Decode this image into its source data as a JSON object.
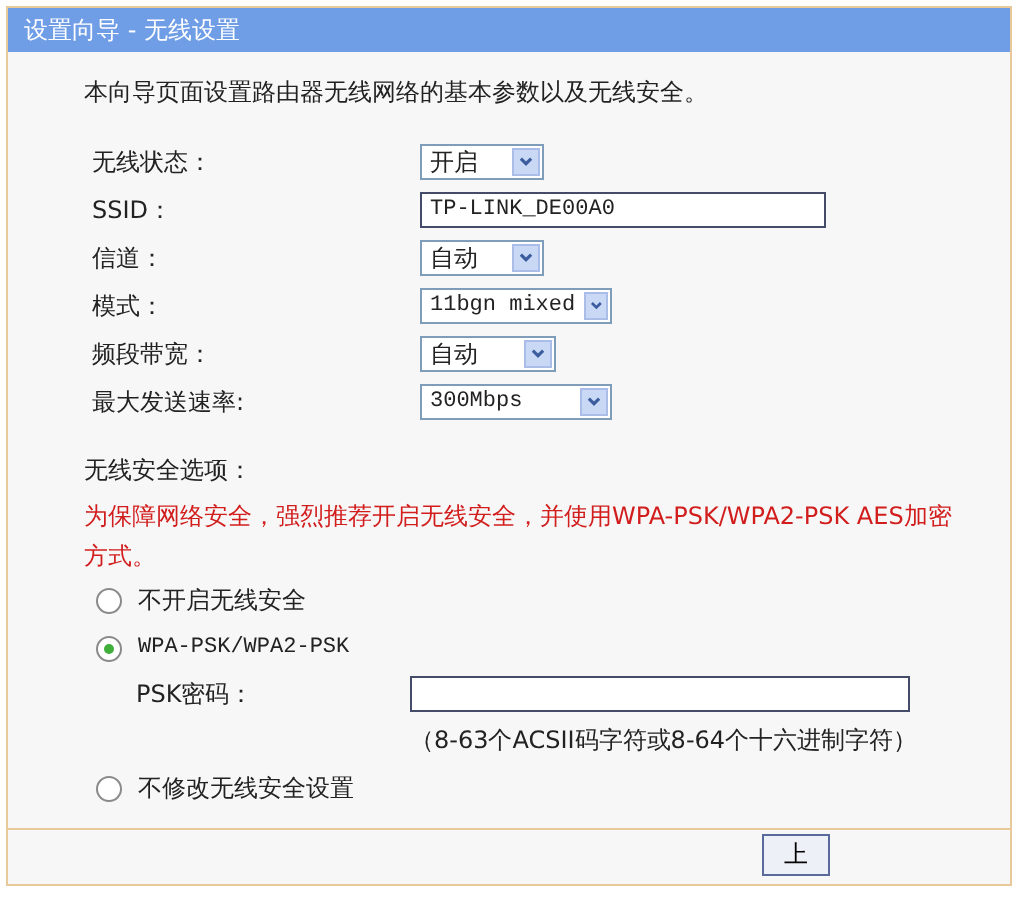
{
  "window": {
    "title": "设置向导 - 无线设置"
  },
  "intro": "本向导页面设置路由器无线网络的基本参数以及无线安全。",
  "fields": [
    {
      "kind": "select",
      "label": "无线状态：",
      "value": "开启"
    },
    {
      "kind": "text",
      "label": "SSID：",
      "value": "TP-LINK_DE00A0"
    },
    {
      "kind": "select",
      "label": "信道：",
      "value": "自动"
    },
    {
      "kind": "select",
      "label": "模式：",
      "value": "11bgn mixed"
    },
    {
      "kind": "select",
      "label": "频段带宽：",
      "value": "自动"
    },
    {
      "kind": "select",
      "label": "最大发送速率:",
      "value": "300Mbps"
    }
  ],
  "security": {
    "heading": "无线安全选项：",
    "warning": "为保障网络安全，强烈推荐开启无线安全，并使用WPA-PSK/WPA2-PSK AES加密方式。",
    "options": [
      {
        "label": "不开启无线安全",
        "selected": false
      },
      {
        "label": "WPA-PSK/WPA2-PSK",
        "selected": true,
        "password": {
          "label": "PSK密码：",
          "hint": "（8-63个ACSII码字符或8-64个十六进制字符）"
        }
      },
      {
        "label": "不修改无线安全设置",
        "selected": false
      }
    ]
  },
  "buttons": [
    "上"
  ]
}
